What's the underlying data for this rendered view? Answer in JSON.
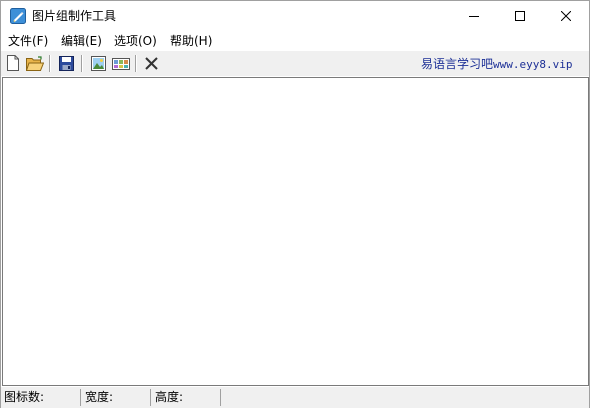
{
  "window": {
    "title": "图片组制作工具",
    "controls": [
      "minimize",
      "maximize",
      "close"
    ]
  },
  "menu": {
    "items": [
      {
        "label": "文件(F)"
      },
      {
        "label": "编辑(E)"
      },
      {
        "label": "选项(O)"
      },
      {
        "label": "帮助(H)"
      }
    ]
  },
  "toolbar": {
    "buttons": [
      {
        "icon": "new-file-icon"
      },
      {
        "icon": "open-folder-icon"
      },
      {
        "icon": "save-icon"
      },
      {
        "icon": "image-icon"
      },
      {
        "icon": "image-group-icon"
      },
      {
        "icon": "delete-icon"
      }
    ],
    "brand_text": "易语言学习吧",
    "brand_url": "www.eyy8.vip"
  },
  "statusbar": {
    "icon_count_label": "图标数:",
    "width_label": "宽度:",
    "height_label": "高度:"
  },
  "colors": {
    "brand": "#1c2f96",
    "toolbar_bg": "#f0f0f0",
    "border": "#a0a0a0"
  }
}
